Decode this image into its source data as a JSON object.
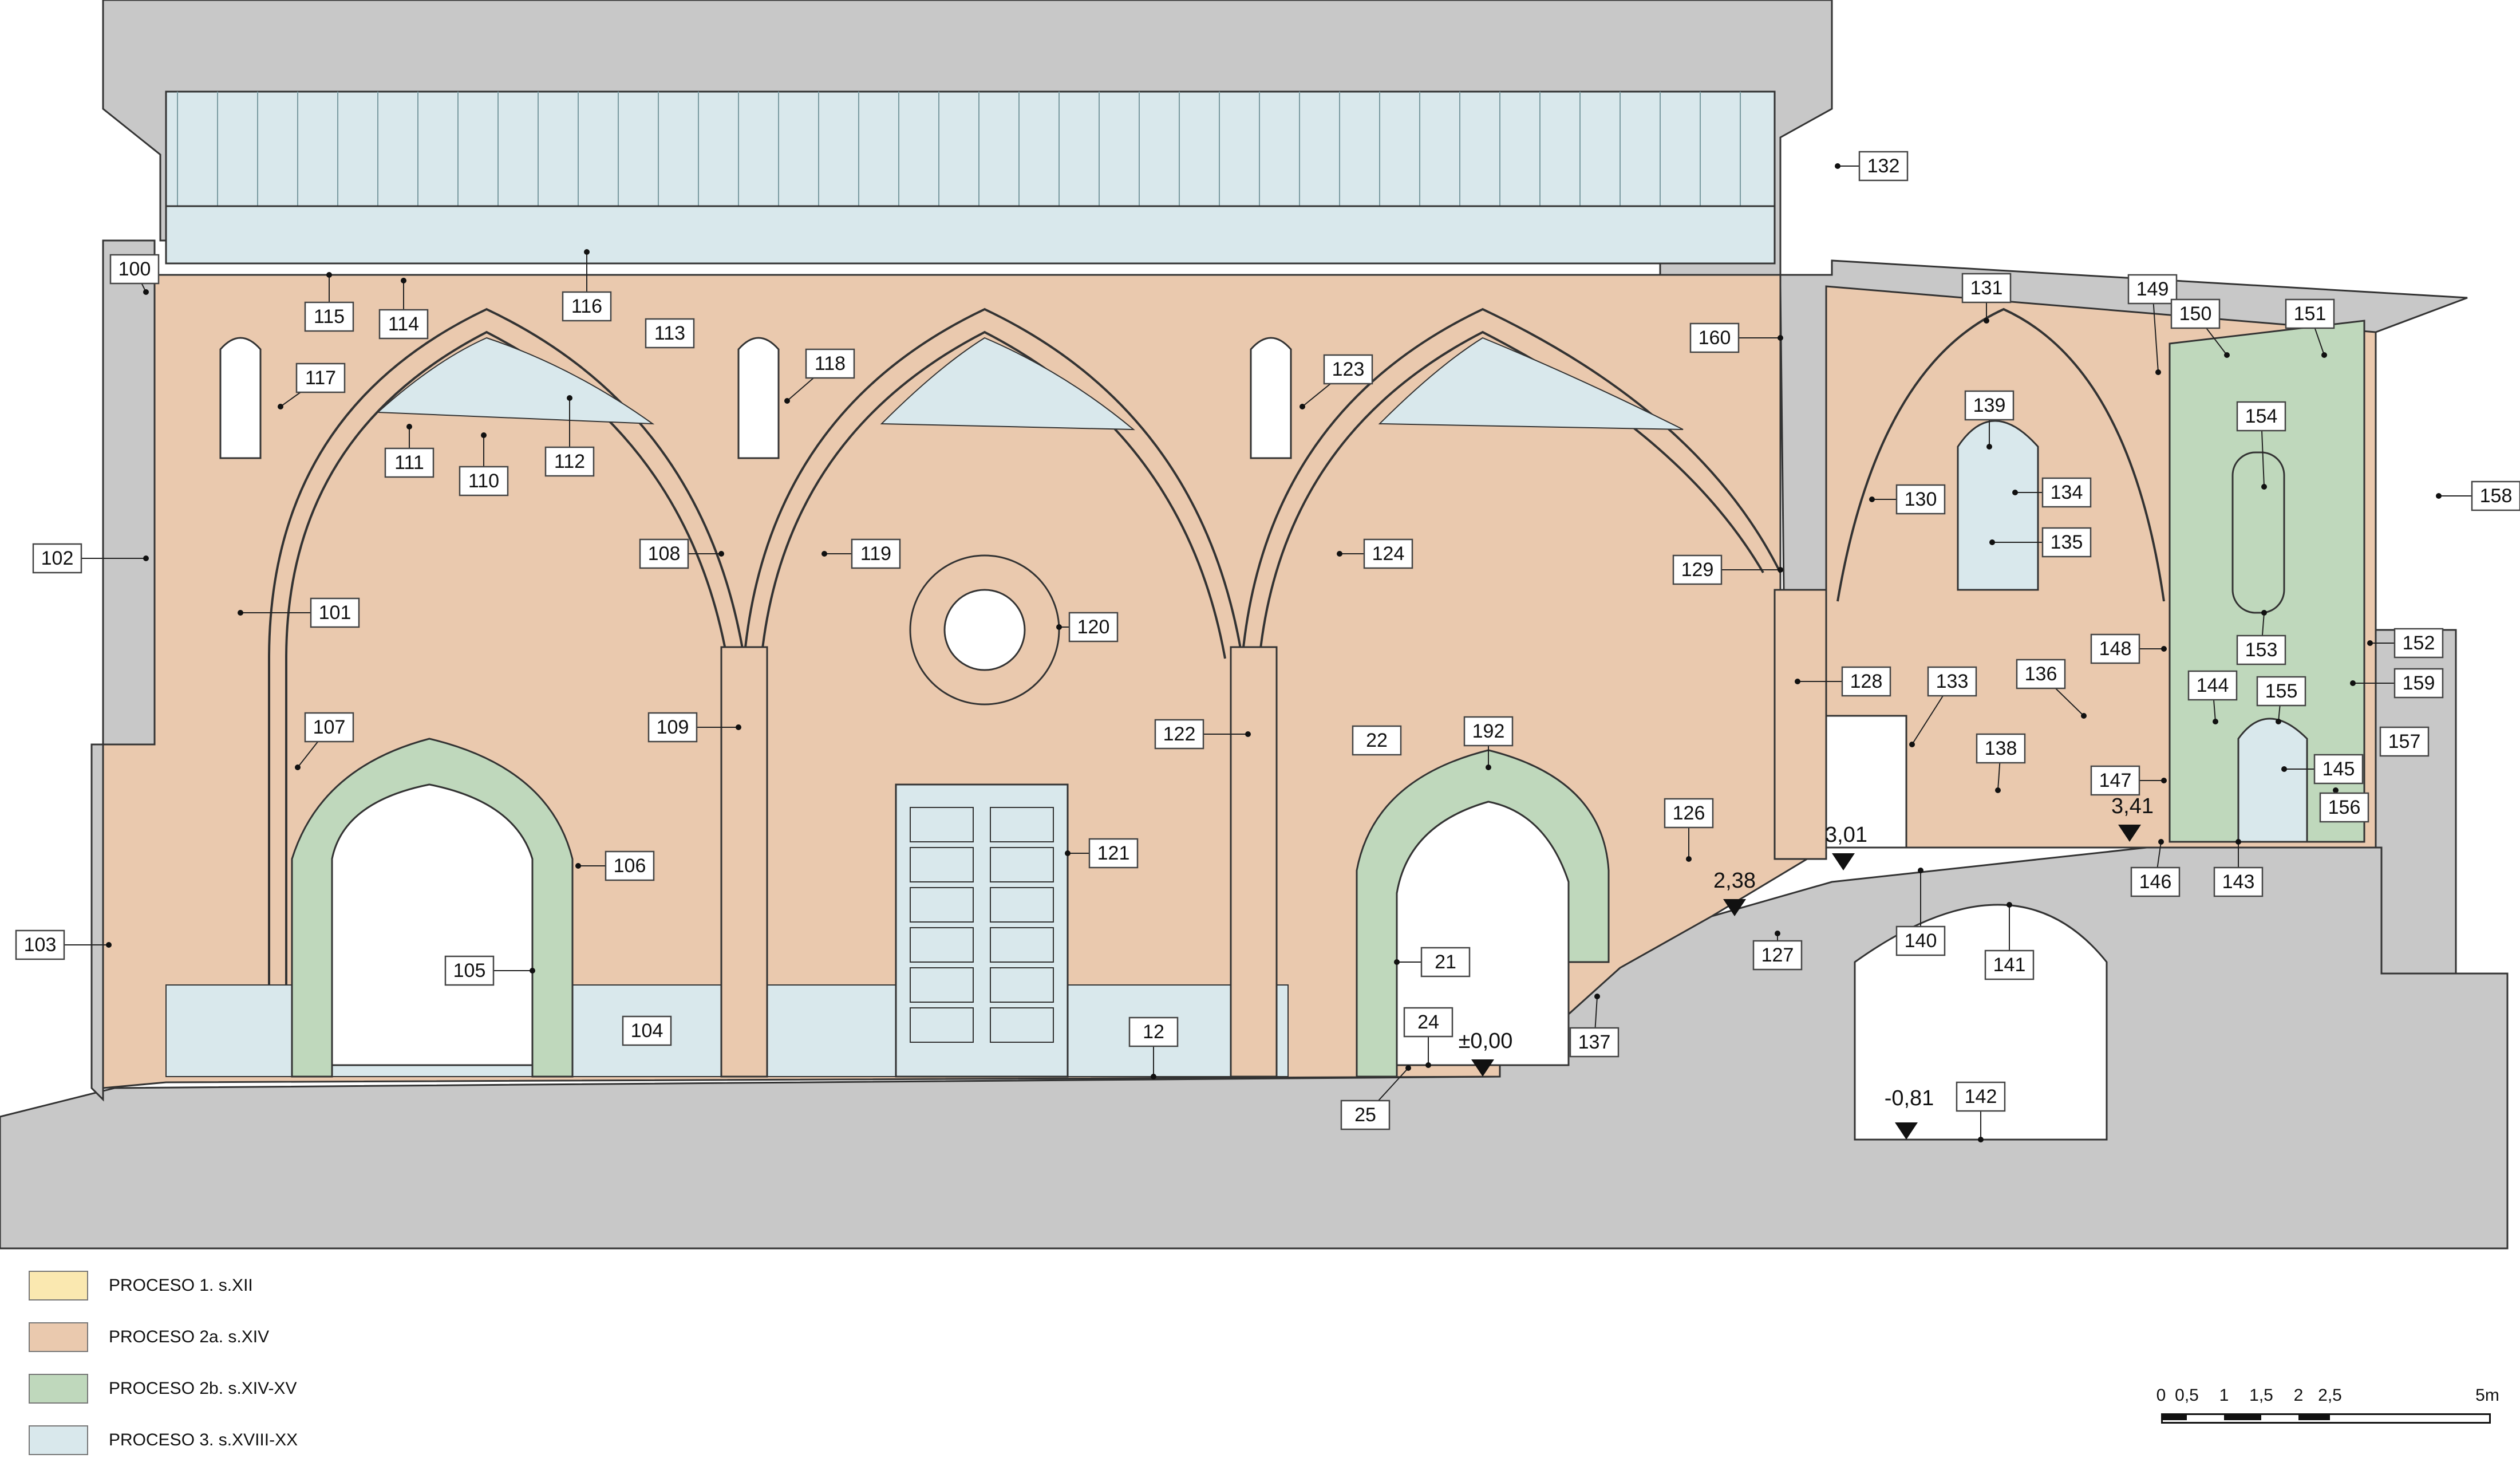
{
  "levels": [
    "±0,00",
    "2,38",
    "3,01",
    "3,41",
    "-0,81"
  ],
  "tags": [
    "100",
    "101",
    "102",
    "103",
    "104",
    "105",
    "106",
    "107",
    "108",
    "109",
    "110",
    "111",
    "112",
    "113",
    "114",
    "115",
    "116",
    "117",
    "118",
    "119",
    "120",
    "121",
    "122",
    "123",
    "124",
    "126",
    "127",
    "128",
    "129",
    "130",
    "131",
    "132",
    "133",
    "134",
    "135",
    "136",
    "137",
    "138",
    "139",
    "140",
    "141",
    "142",
    "143",
    "144",
    "145",
    "146",
    "147",
    "148",
    "149",
    "150",
    "151",
    "152",
    "153",
    "154",
    "155",
    "156",
    "157",
    "158",
    "159",
    "160",
    "192",
    "12",
    "21",
    "22",
    "24",
    "25"
  ],
  "legend": [
    {
      "label": "PROCESO 1. s.XII",
      "color": "#fae8b0"
    },
    {
      "label": "PROCESO 2a. s.XIV",
      "color": "#eac9ae"
    },
    {
      "label": "PROCESO 2b. s.XIV-XV",
      "color": "#bfd8bc"
    },
    {
      "label": "PROCESO 3. s.XVIII-XX",
      "color": "#d9e8ec"
    }
  ],
  "scale": {
    "ticks": [
      "0",
      "0,5",
      "1",
      "1,5",
      "2",
      "2,5",
      "5m"
    ]
  },
  "colors": {
    "ground": "#c8c8c8",
    "stone": "#eac9ae",
    "green": "#bfd8bc",
    "blue": "#d9e8ec",
    "line": "#333333"
  }
}
